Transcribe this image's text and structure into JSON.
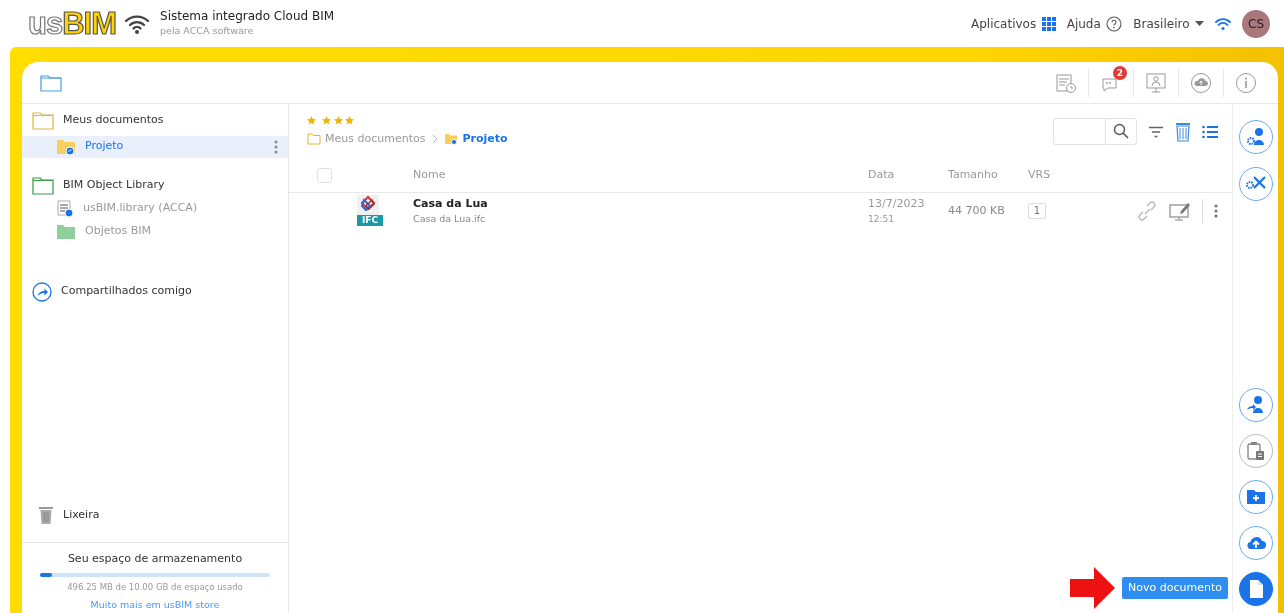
{
  "header": {
    "logo": {
      "light": "us",
      "bold": "BIM"
    },
    "title": "Sistema integrado Cloud BIM",
    "subtitle": "pela ACCA software",
    "links": [
      {
        "label": "Aplicativos",
        "kind": "apps"
      },
      {
        "label": "Ajuda",
        "kind": "help"
      },
      {
        "label": "Brasileiro",
        "kind": "language"
      }
    ],
    "avatar": "CS"
  },
  "toolbar": {
    "notification_count": "2"
  },
  "sidebar": {
    "sections": [
      {
        "label": "Meus documentos",
        "kind": "folder",
        "selected": false,
        "children": [
          {
            "label": "Projeto",
            "kind": "shared-folder",
            "selected": true
          }
        ]
      },
      {
        "label": "BIM Object Library",
        "kind": "library",
        "selected": false,
        "children": [
          {
            "label": "usBIM.library (ACCA)",
            "kind": "library-file",
            "selected": false
          },
          {
            "label": "Objetos BIM",
            "kind": "green-folder",
            "selected": false
          }
        ]
      },
      {
        "label": "Compartilhados comigo",
        "kind": "shared",
        "selected": false
      }
    ],
    "trash": "Lixeira",
    "storage": {
      "title": "Seu espaço de armazenamento",
      "level": 0.05,
      "usage": "496.25 MB de 10.00 GB de espaço usado",
      "link": "Muito mais em usBIM store"
    }
  },
  "main": {
    "stars": 4,
    "breadcrumb": [
      {
        "label": "Meus documentos",
        "selected": false
      },
      {
        "label": "Projeto",
        "selected": true
      }
    ],
    "table": {
      "all_checked": false,
      "columns": [
        "Nome",
        "Data",
        "Tamanho",
        "VRS"
      ],
      "rows": [
        {
          "name": "Casa da Lua",
          "file": "Casa da Lua.ifc",
          "badge": "IFC",
          "date": "13/7/2023",
          "time": "12:51",
          "size": "44 700 KB",
          "version": "1",
          "checked": false
        }
      ]
    }
  },
  "tooltip": "Novo documento"
}
